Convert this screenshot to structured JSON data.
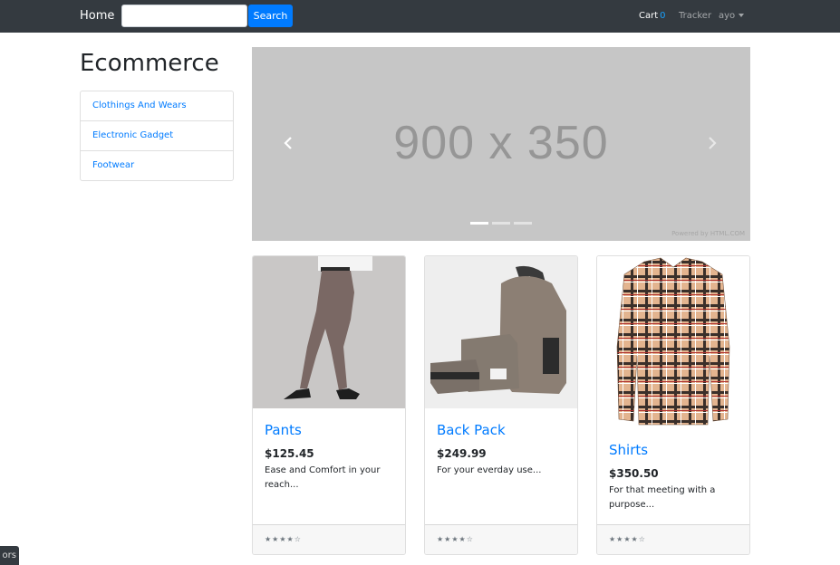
{
  "navbar": {
    "brand": "Home",
    "search_placeholder": "",
    "search_button": "Search",
    "cart_label": "Cart",
    "cart_count": "0",
    "tracker": "Tracker",
    "user": "ayo"
  },
  "sidebar": {
    "title": "Ecommerce",
    "categories": [
      {
        "label": "Clothings And Wears"
      },
      {
        "label": "Electronic Gadget"
      },
      {
        "label": "Footwear"
      }
    ]
  },
  "carousel": {
    "placeholder_text": "900 x 350",
    "powered_by": "Powered by HTML.COM",
    "prev_icon": "‹",
    "next_icon": "›",
    "indicator_count": 3,
    "active_indicator": 0
  },
  "products": [
    {
      "name": "Pants",
      "price": "$125.45",
      "description": "Ease and Comfort in your reach...",
      "rating": "★★★★☆",
      "image_icon": "pants-image"
    },
    {
      "name": "Back Pack",
      "price": "$249.99",
      "description": "For your everday use...",
      "rating": "★★★★☆",
      "image_icon": "backpack-image"
    },
    {
      "name": "Shirts",
      "price": "$350.50",
      "description": "For that meeting with a purpose...",
      "rating": "★★★★☆",
      "image_icon": "shirt-image"
    }
  ],
  "corner_tab": {
    "label": "ors"
  },
  "colors": {
    "navbar_bg": "#343a40",
    "primary": "#007bff",
    "carousel_bg": "#c6c6c6"
  }
}
